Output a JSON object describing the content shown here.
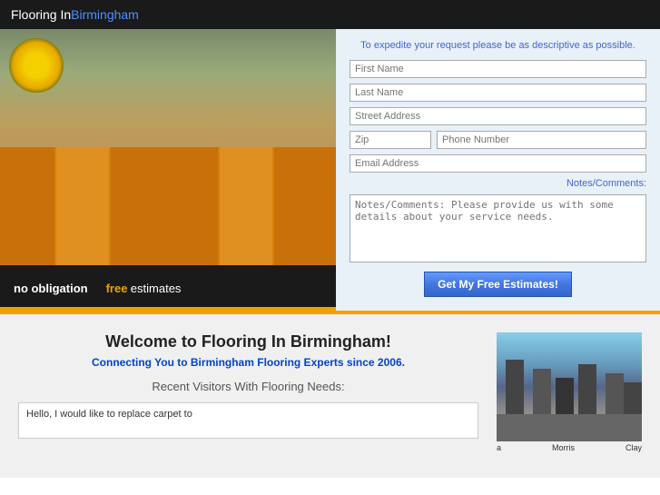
{
  "header": {
    "title_plain": "Flooring In ",
    "title_blue": "Birmingham"
  },
  "hero": {
    "form": {
      "hint": "To expedite your request please be as descriptive as possible.",
      "first_name_placeholder": "First Name",
      "last_name_placeholder": "Last Name",
      "street_placeholder": "Street Address",
      "zip_placeholder": "Zip",
      "phone_placeholder": "Phone Number",
      "email_placeholder": "Email Address",
      "notes_label": "Notes/Comments:",
      "notes_placeholder": "Notes/Comments: Please provide us with some details about your service needs.",
      "submit_label": "Get My Free Estimates!"
    },
    "bottom_bar": {
      "no_obligation": "no obligation",
      "free": "free",
      "estimates": "estimates"
    }
  },
  "lower": {
    "heading": "Welcome to Flooring In Birmingham!",
    "subtitle": "Connecting You to Birmingham Flooring Experts since 2006.",
    "recent_visitors_label": "Recent Visitors With Flooring Needs:",
    "comment_preview": "Hello, I would like to replace carpet to",
    "city_labels": {
      "left": "a",
      "middle": "Morris",
      "right": "Clay"
    }
  }
}
